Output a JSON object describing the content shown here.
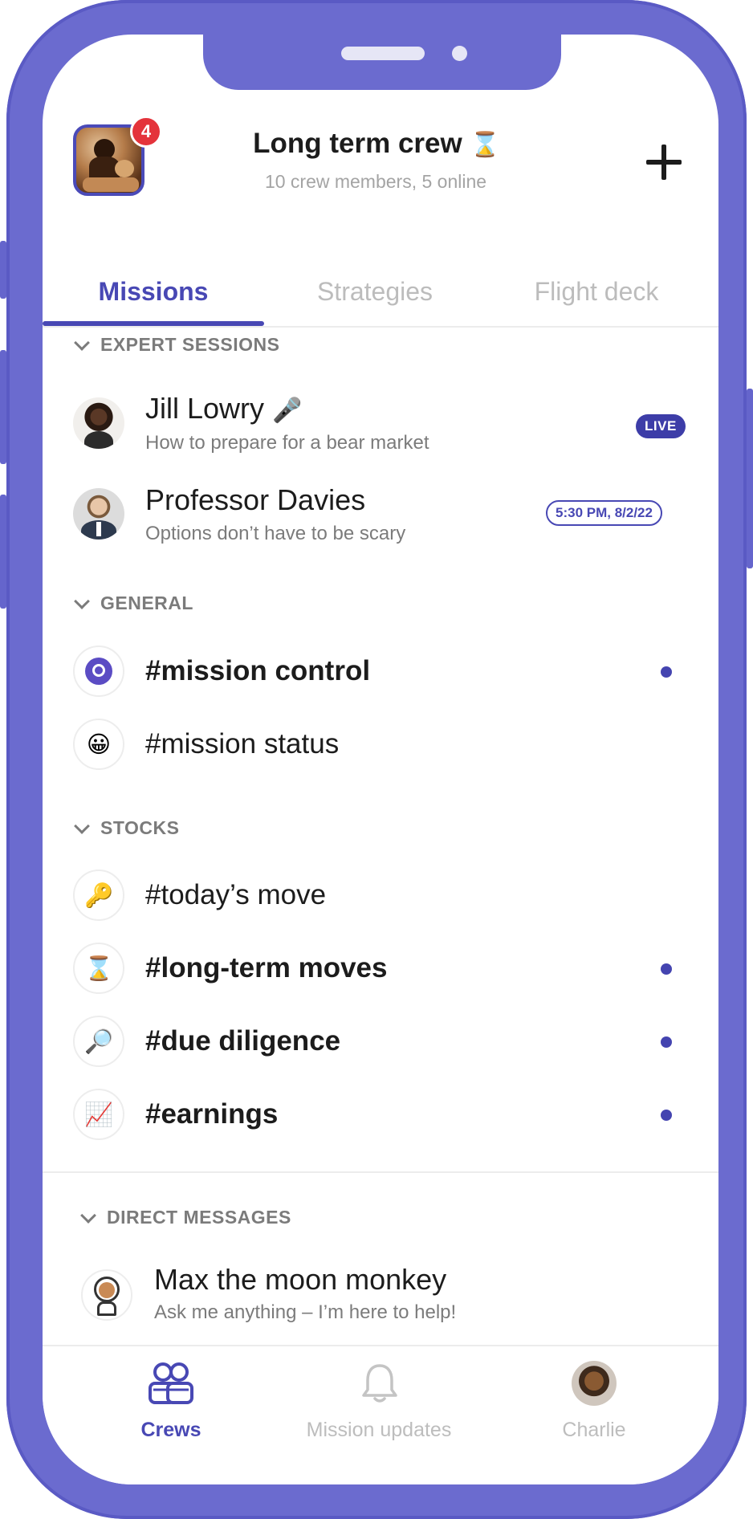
{
  "header": {
    "crew_name": "Long term crew",
    "crew_emoji": "⌛",
    "crew_subtitle": "10 crew members, 5 online",
    "notification_count": "4"
  },
  "tabs": [
    {
      "label": "Missions",
      "active": true
    },
    {
      "label": "Strategies",
      "active": false
    },
    {
      "label": "Flight deck",
      "active": false
    }
  ],
  "sections": {
    "expert_sessions": {
      "title": "EXPERT SESSIONS",
      "items": [
        {
          "name": "Jill Lowry",
          "emoji": "🎤",
          "subtitle": "How to prepare for a bear market",
          "status": "LIVE"
        },
        {
          "name": "Professor Davies",
          "subtitle": "Options don’t have to be scary",
          "status": "5:30 PM, 8/2/22"
        }
      ]
    },
    "general": {
      "title": "GENERAL",
      "channels": [
        {
          "name": "#mission control",
          "icon": "💬",
          "unread": true
        },
        {
          "name": "#mission status",
          "icon": "😀",
          "unread": false
        }
      ]
    },
    "stocks": {
      "title": "STOCKS",
      "channels": [
        {
          "name": "#today’s move",
          "icon": "🔑",
          "unread": false
        },
        {
          "name": "#long-term moves",
          "icon": "⌛",
          "unread": true
        },
        {
          "name": "#due diligence",
          "icon": "🔎",
          "unread": true
        },
        {
          "name": "#earnings",
          "icon": "📈",
          "unread": true
        }
      ]
    },
    "direct_messages": {
      "title": "DIRECT MESSAGES",
      "items": [
        {
          "name": "Max the moon monkey",
          "subtitle": "Ask me anything – I’m here to help!"
        }
      ]
    }
  },
  "bottom_nav": [
    {
      "label": "Crews",
      "icon": "crews-icon",
      "active": true
    },
    {
      "label": "Mission updates",
      "icon": "bell-icon",
      "active": false
    },
    {
      "label": "Charlie",
      "icon": "profile-avatar",
      "active": false
    }
  ],
  "colors": {
    "brand": "#6b6bcf",
    "accent": "#4848b4",
    "badge": "#e4333b"
  }
}
